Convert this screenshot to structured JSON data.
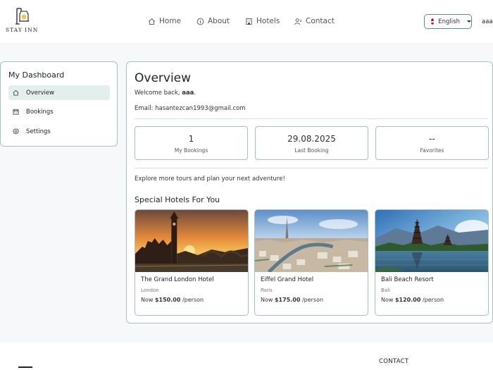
{
  "brand": {
    "name": "STAY INN"
  },
  "nav": {
    "items": [
      {
        "label": "Home",
        "icon": "home-icon"
      },
      {
        "label": "About",
        "icon": "info-icon"
      },
      {
        "label": "Hotels",
        "icon": "hotel-icon"
      },
      {
        "label": "Contact",
        "icon": "contact-icon"
      }
    ],
    "language": "English",
    "user": "aaa"
  },
  "sidebar": {
    "title": "My Dashboard",
    "items": [
      {
        "label": "Overview",
        "icon": "home-icon",
        "active": true
      },
      {
        "label": "Bookings",
        "icon": "calendar-icon",
        "active": false
      },
      {
        "label": "Settings",
        "icon": "gear-icon",
        "active": false
      }
    ]
  },
  "overview": {
    "title": "Overview",
    "welcome_prefix": "Welcome back,",
    "username": "aaa",
    "welcome_suffix": ".",
    "email_label": "Email:",
    "email": "hasantezcan1993@gmail.com",
    "stats": [
      {
        "value": "1",
        "label": "My Bookings"
      },
      {
        "value": "29.08.2025",
        "label": "Last Booking"
      },
      {
        "value": "--",
        "label": "Favorites"
      }
    ],
    "explore_text": "Explore more tours and plan your next adventure!",
    "special_title": "Special Hotels For You"
  },
  "hotels": [
    {
      "name": "The Grand London Hotel",
      "city": "London",
      "price_prefix": "Now",
      "price": "$150.00",
      "unit": "/person"
    },
    {
      "name": "Eiffel Grand Hotel",
      "city": "Paris",
      "price_prefix": "Now",
      "price": "$175.00",
      "unit": "/person"
    },
    {
      "name": "Bali Beach Resort",
      "city": "Bali",
      "price_prefix": "Now",
      "price": "$120.00",
      "unit": "/person"
    }
  ],
  "footer": {
    "contact_heading": "CONTACT"
  },
  "colors": {
    "accent_border": "#9fc3bf",
    "active_bg": "#e3efed",
    "page_bg": "#f7f8fa"
  }
}
